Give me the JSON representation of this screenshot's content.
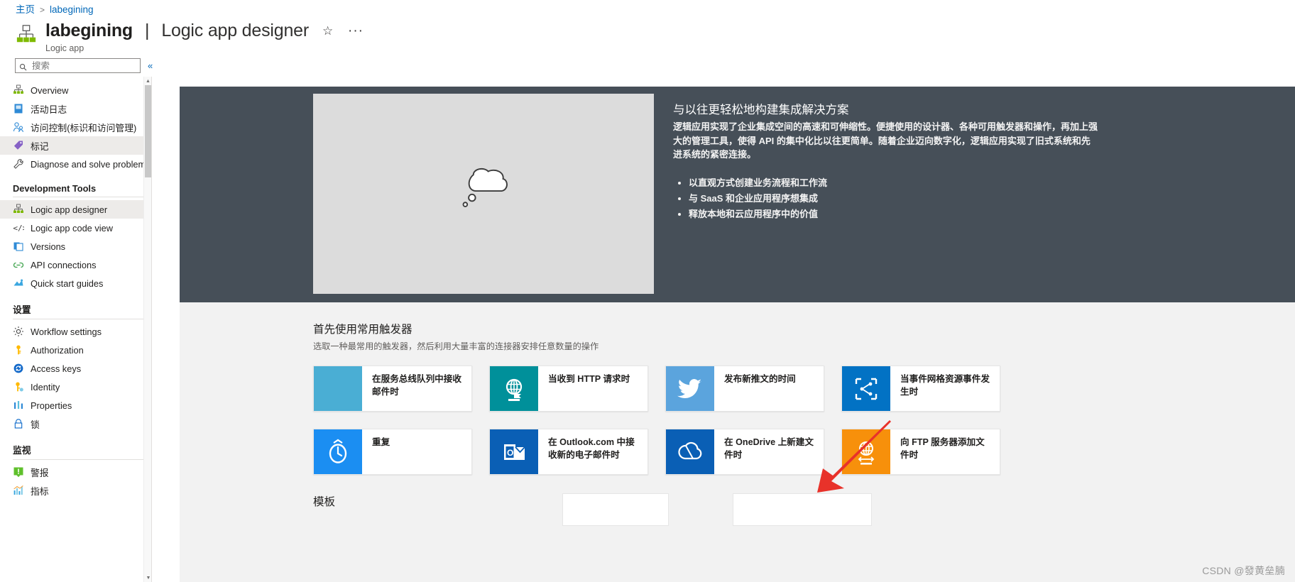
{
  "breadcrumb": {
    "home": "主页",
    "current": "labegining",
    "separator": ">"
  },
  "header": {
    "resource_name": "labegining",
    "divider": "|",
    "page_kind": "Logic app designer",
    "caption": "Logic app",
    "favorite_icon": "☆",
    "more_icon": "···",
    "title_icon": "logic-app-icon"
  },
  "search": {
    "placeholder": "搜索",
    "value": "",
    "icon": "search-icon",
    "collapse_icon": "«"
  },
  "sidebar": {
    "items": [
      {
        "label": "Overview",
        "icon": "logic-app-icon",
        "selected": false,
        "type": "item"
      },
      {
        "label": "活动日志",
        "icon": "activity-log-icon",
        "selected": false,
        "type": "item"
      },
      {
        "label": "访问控制(标识和访问管理)",
        "icon": "access-control-icon",
        "selected": false,
        "type": "item"
      },
      {
        "label": "标记",
        "icon": "tag-icon",
        "selected": true,
        "type": "item"
      },
      {
        "label": "Diagnose and solve problems",
        "icon": "wrench-icon",
        "selected": false,
        "type": "item"
      },
      {
        "label": "Development Tools",
        "type": "group"
      },
      {
        "label": "Logic app designer",
        "icon": "logic-app-icon",
        "selected": true,
        "type": "item"
      },
      {
        "label": "Logic app code view",
        "icon": "code-icon",
        "selected": false,
        "type": "item"
      },
      {
        "label": "Versions",
        "icon": "versions-icon",
        "selected": false,
        "type": "item"
      },
      {
        "label": "API connections",
        "icon": "api-connections-icon",
        "selected": false,
        "type": "item"
      },
      {
        "label": "Quick start guides",
        "icon": "quick-start-icon",
        "selected": false,
        "type": "item"
      },
      {
        "label": "设置",
        "type": "group"
      },
      {
        "label": "Workflow settings",
        "icon": "gear-icon",
        "selected": false,
        "type": "item"
      },
      {
        "label": "Authorization",
        "icon": "key-icon",
        "selected": false,
        "type": "item"
      },
      {
        "label": "Access keys",
        "icon": "access-keys-icon",
        "selected": false,
        "type": "item"
      },
      {
        "label": "Identity",
        "icon": "identity-icon",
        "selected": false,
        "type": "item"
      },
      {
        "label": "Properties",
        "icon": "properties-icon",
        "selected": false,
        "type": "item"
      },
      {
        "label": "锁",
        "icon": "lock-icon",
        "selected": false,
        "type": "item"
      },
      {
        "label": "监视",
        "type": "group"
      },
      {
        "label": "警报",
        "icon": "alert-icon",
        "selected": false,
        "type": "item"
      },
      {
        "label": "指标",
        "icon": "metrics-icon",
        "selected": false,
        "type": "item"
      }
    ]
  },
  "hero": {
    "heading": "与以往更轻松地构建集成解决方案",
    "paragraph": "逻辑应用实现了企业集成空间的高速和可伸缩性。便捷使用的设计器、各种可用触发器和操作，再加上强大的管理工具，使得 API 的集中化比以往更简单。随着企业迈向数字化，逻辑应用实现了旧式系统和先进系统的紧密连接。",
    "bullets": [
      "以直观方式创建业务流程和工作流",
      "与 SaaS 和企业应用程序想集成",
      "释放本地和云应用程序中的价值"
    ],
    "video_placeholder_icon": "thought-bubble-icon"
  },
  "triggers": {
    "heading": "首先使用常用触发器",
    "subheading": "选取一种最常用的触发器，然后利用大量丰富的连接器安排任意数量的操作",
    "tiles": [
      {
        "label": "在服务总线队列中接收邮件时",
        "icon": "service-bus-icon",
        "color": "#4aaed4"
      },
      {
        "label": "当收到 HTTP 请求时",
        "icon": "http-request-icon",
        "color": "#00909a"
      },
      {
        "label": "发布新推文的时间",
        "icon": "twitter-icon",
        "color": "#5ba4dd"
      },
      {
        "label": "当事件网格资源事件发生时",
        "icon": "event-grid-icon",
        "color": "#0272c4"
      },
      {
        "label": "重复",
        "icon": "recurrence-clock-icon",
        "color": "#1b8ef2"
      },
      {
        "label": "在 Outlook.com 中接收新的电子邮件时",
        "icon": "outlook-icon",
        "color": "#0a5fb5"
      },
      {
        "label": "在 OneDrive 上新建文件时",
        "icon": "onedrive-icon",
        "color": "#0a5fb5"
      },
      {
        "label": "向 FTP 服务器添加文件时",
        "icon": "ftp-globe-icon",
        "color": "#f7900b"
      }
    ]
  },
  "templates": {
    "heading": "模板"
  },
  "watermark": "CSDN @發黄垒腩",
  "colors": {
    "accent_link": "#0067b8",
    "hero_bg": "#464f58",
    "canvas_bg": "#f2f2f2",
    "selected_nav": "#edebe9",
    "arrow_red": "#e8322a"
  }
}
